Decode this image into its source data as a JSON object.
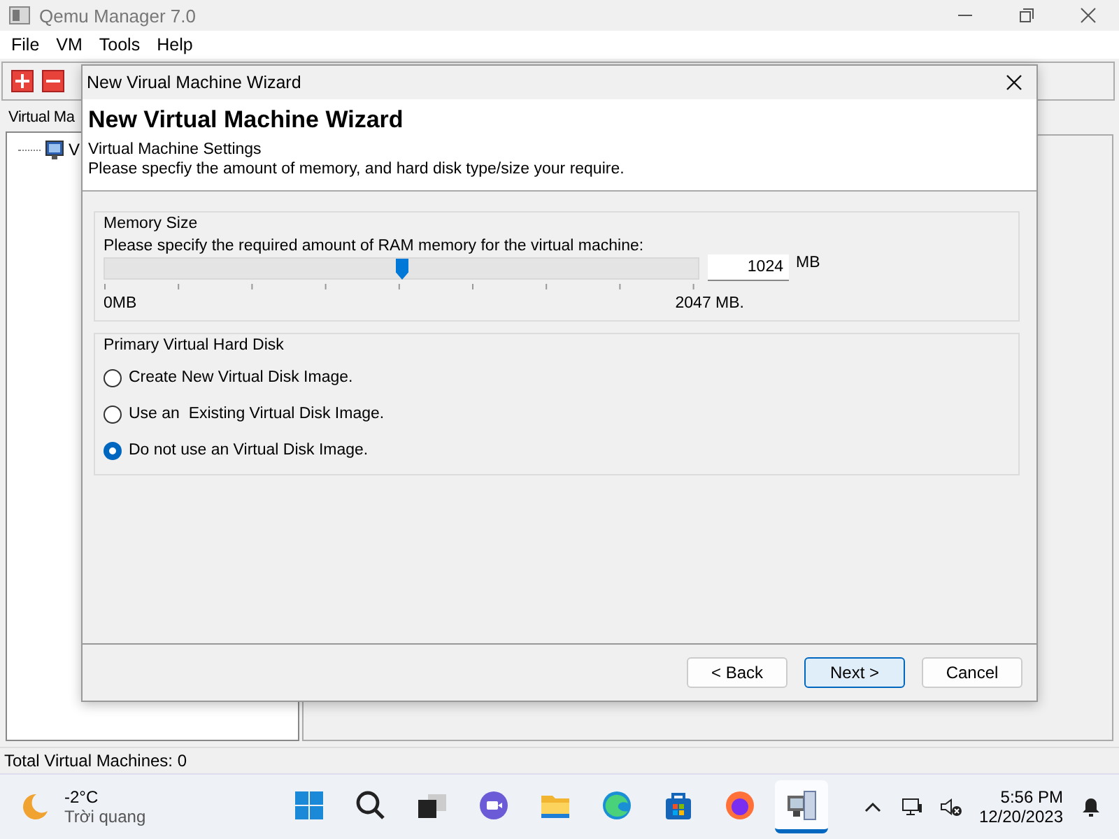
{
  "window": {
    "title": "Qemu Manager 7.0"
  },
  "menu": [
    "File",
    "VM",
    "Tools",
    "Help"
  ],
  "left_panel": {
    "tab": "Virtual Ma",
    "tree": [
      {
        "label": "V"
      }
    ]
  },
  "dialog": {
    "title": "New Virual Machine Wizard",
    "heading": "New Virtual Machine Wizard",
    "subheading": "Virtual Machine Settings",
    "description": "Please specfiy the amount of memory, and hard disk type/size your require.",
    "memory": {
      "group": "Memory Size",
      "prompt": "Please specify the required amount of RAM memory for the virtual machine:",
      "level": 0.5,
      "value": "1024",
      "unit": "MB",
      "min_label": "0MB",
      "max_label": "2047 MB."
    },
    "disk": {
      "group": "Primary Virtual Hard Disk",
      "options": [
        {
          "label": "Create New Virtual Disk Image.",
          "selected": false
        },
        {
          "label": "Use an  Existing Virtual Disk Image.",
          "selected": false
        },
        {
          "label": "Do not use an Virtual Disk Image.",
          "selected": true
        }
      ]
    },
    "buttons": [
      {
        "label": "< Back",
        "default": false
      },
      {
        "label": "Next >",
        "default": true
      },
      {
        "label": "Cancel",
        "default": false
      }
    ]
  },
  "status_bar": {
    "text": "Total Virtual Machines: 0"
  },
  "taskbar": {
    "weather": {
      "temp": "-2°C",
      "condition": "Trời quang"
    },
    "apps": [
      {
        "kind": "start",
        "selected": false
      },
      {
        "kind": "search",
        "selected": false
      },
      {
        "kind": "taskview",
        "selected": false
      },
      {
        "kind": "chat",
        "selected": false
      },
      {
        "kind": "folder",
        "selected": false
      },
      {
        "kind": "edge",
        "selected": false
      },
      {
        "kind": "store",
        "selected": false
      },
      {
        "kind": "firefox",
        "selected": false
      },
      {
        "kind": "qemu",
        "selected": true
      }
    ],
    "clock": {
      "time": "5:56 PM",
      "date": "12/20/2023"
    }
  }
}
